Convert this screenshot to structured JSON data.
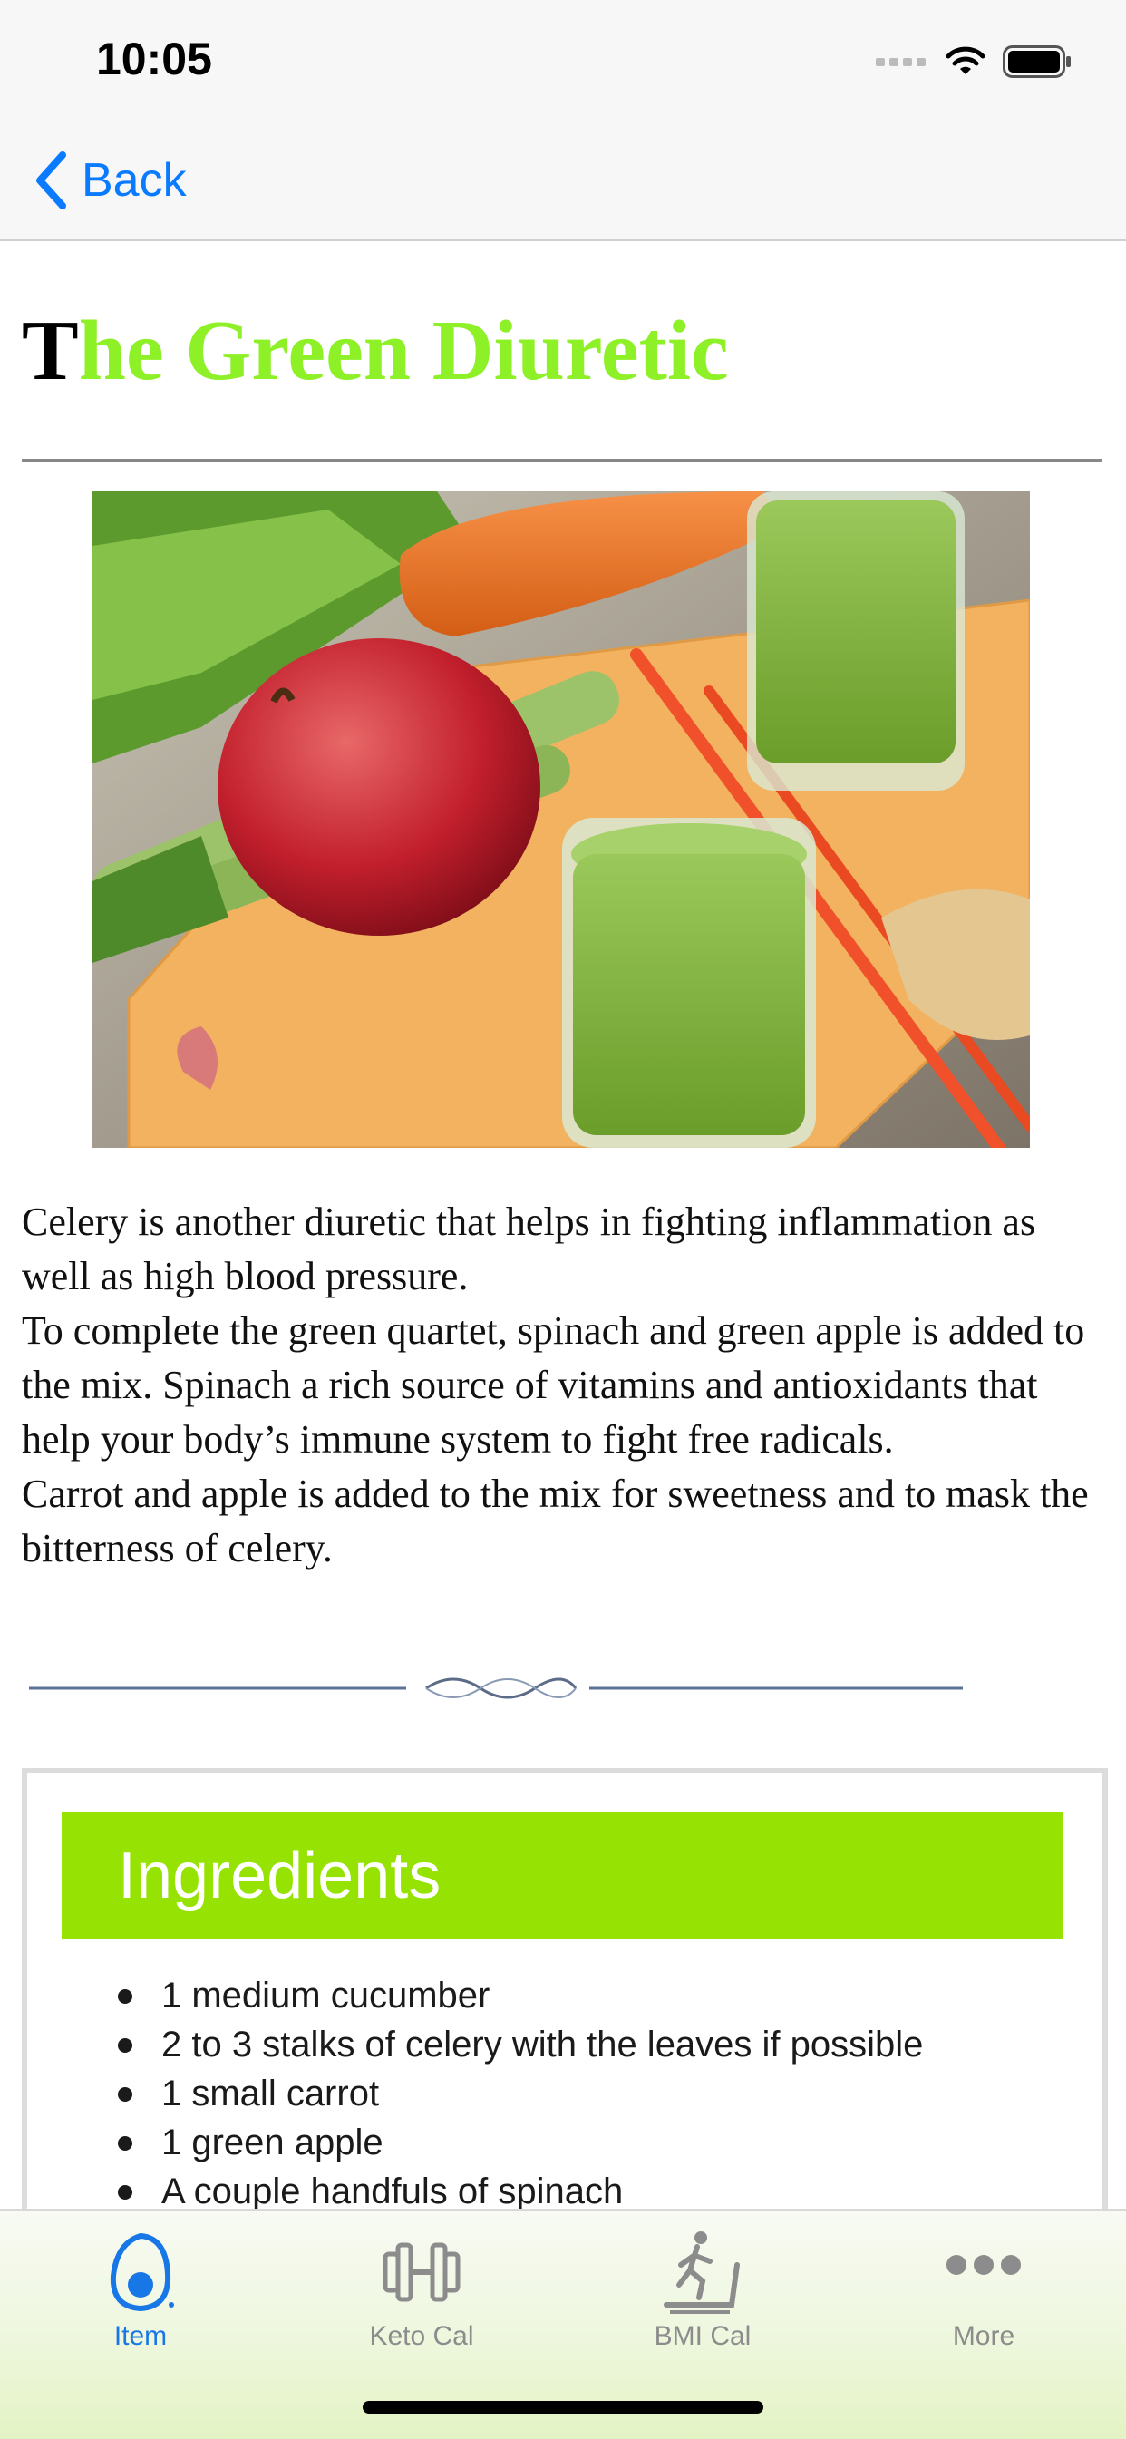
{
  "status_bar": {
    "time": "10:05"
  },
  "nav": {
    "back_label": "Back"
  },
  "article": {
    "title_first_letter": "T",
    "title_rest": "he Green Diuretic",
    "paragraphs": [
      " Celery is another diuretic that helps in fighting inflammation as well as high blood pressure.",
      "To complete the green quartet, spinach and green apple is added to the mix. Spinach a rich source of vitamins and antioxidants that help your body’s immune system to fight free radicals.",
      "Carrot and apple is added to the mix for sweetness and to mask the bitterness of celery."
    ]
  },
  "ingredients": {
    "title": "Ingredients",
    "items": [
      "1 medium cucumber",
      "2 to 3 stalks of celery with the leaves if possible",
      "1 small carrot",
      "1 green apple",
      "A couple handfuls of spinach"
    ]
  },
  "tab_bar": {
    "tabs": [
      {
        "label": "Item",
        "icon": "avocado-icon",
        "active": true
      },
      {
        "label": "Keto Cal",
        "icon": "dumbbell-icon",
        "active": false
      },
      {
        "label": "BMI Cal",
        "icon": "treadmill-icon",
        "active": false
      },
      {
        "label": "More",
        "icon": "more-icon",
        "active": false
      }
    ]
  },
  "colors": {
    "accent_blue": "#0a7aff",
    "title_green": "#8ef026",
    "ingredients_header": "#96e303",
    "tab_active": "#1877e6",
    "tab_inactive": "#8c8c8c"
  }
}
